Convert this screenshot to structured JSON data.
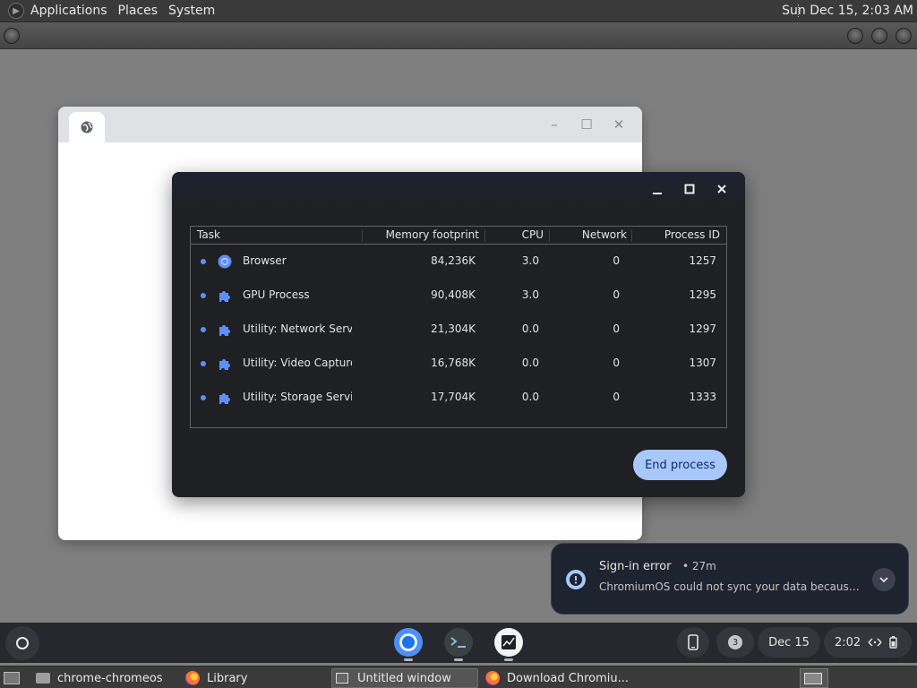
{
  "top_panel": {
    "menus": [
      "Applications",
      "Places",
      "System"
    ],
    "clock": "Sun Dec 15,  2:03 AM"
  },
  "task_manager": {
    "columns": [
      "Task",
      "Memory footprint",
      "CPU",
      "Network",
      "Process ID"
    ],
    "rows": [
      {
        "task": "Browser",
        "memory": "84,236K",
        "cpu": "3.0",
        "network": "0",
        "pid": "1257",
        "icon": "chrome-icon"
      },
      {
        "task": "GPU Process",
        "memory": "90,408K",
        "cpu": "3.0",
        "network": "0",
        "pid": "1295",
        "icon": "puzzle-icon"
      },
      {
        "task": "Utility: Network Service",
        "memory": "21,304K",
        "cpu": "0.0",
        "network": "0",
        "pid": "1297",
        "icon": "puzzle-icon"
      },
      {
        "task": "Utility: Video Capture",
        "memory": "16,768K",
        "cpu": "0.0",
        "network": "0",
        "pid": "1307",
        "icon": "puzzle-icon"
      },
      {
        "task": "Utility: Storage Service",
        "memory": "17,704K",
        "cpu": "0.0",
        "network": "0",
        "pid": "1333",
        "icon": "puzzle-icon"
      }
    ],
    "end_process_label": "End process"
  },
  "notification": {
    "title": "Sign-in error",
    "time": "• 27m",
    "message": "ChromiumOS could not sync your data because your account sign-in details are out of date."
  },
  "shelf": {
    "notification_count": "3",
    "date": "Dec 15",
    "time": "2:02"
  },
  "bottom_panel": {
    "tasks": [
      {
        "label": "chrome-chromeos",
        "icon": "folder-icon"
      },
      {
        "label": "Library",
        "icon": "firefox-icon"
      },
      {
        "label": "Untitled window",
        "icon": "window-icon",
        "active": true
      },
      {
        "label": "Download Chromiu...",
        "icon": "firefox-icon"
      }
    ]
  },
  "colors": {
    "accent": "#a8c7fa",
    "dialog_bg": "#1f2023",
    "shelf_bg": "#26282e",
    "panel_bg": "#3a3a3a"
  }
}
